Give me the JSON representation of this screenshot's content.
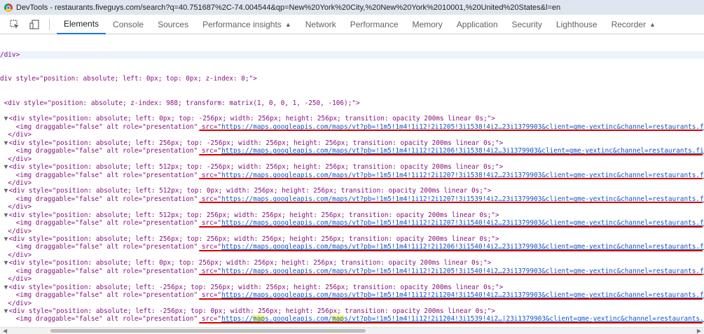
{
  "window": {
    "title": "DevTools - restaurants.fiveguys.com/search?q=40.751687%2C-74.004544&qp=New%20York%20City,%20New%20York%2010001,%20United%20States&l=en"
  },
  "toolbar": {
    "inspect_icon": "element-picker-icon",
    "device_icon": "device-toolbar-icon",
    "tabs": [
      {
        "label": "Elements",
        "active": true
      },
      {
        "label": "Console"
      },
      {
        "label": "Sources"
      },
      {
        "label": "Performance insights",
        "flask": true
      },
      {
        "label": "Network"
      },
      {
        "label": "Performance"
      },
      {
        "label": "Memory"
      },
      {
        "label": "Application"
      },
      {
        "label": "Security"
      },
      {
        "label": "Lighthouse"
      },
      {
        "label": "Recorder",
        "flask": true
      }
    ]
  },
  "code": {
    "line0": "/div>",
    "line1": "div style=\"position: absolute; left: 0px; top: 0px; z-index: 0;\">",
    "line2": "<div style=\"position: absolute; z-index: 988; transform: matrix(1, 0, 0, 1, -250, -106);\">",
    "close_div": "</div>",
    "img_prefix": "<img draggable=\"false\" alt role=\"presentation\" src=\"",
    "blocks": [
      {
        "div": "<div style=\"position: absolute; left: 0px; top: -256px; width: 256px; height: 256px; transition: opacity 200ms linear 0s;\">",
        "url": "https://maps.googleapis.com/maps/vt?pb=!1m5!1m4!1i12!2i1205!3i1538!4i2…23i1379903&client=gme-yextinc&channel=restaurants.five"
      },
      {
        "div": "<div style=\"position: absolute; left: 256px; top: -256px; width: 256px; height: 256px; transition: opacity 200ms linear 0s;\">",
        "url": "https://maps.googleapis.com/maps/vt?pb=!1m5!1m4!1i12!2i1206!3i1538!4i2…3i1379903&client=gme-yextinc&channel=restaurants.fiveg"
      },
      {
        "div": "<div style=\"position: absolute; left: 512px; top: -256px; width: 256px; height: 256px; transition: opacity 200ms linear 0s;\">",
        "url": "https://maps.googleapis.com/maps/vt?pb=!1m5!1m4!1i12!2i1207!3i1538!4i2…23i1379903&client=gme-yextinc&channel=restaurants.five"
      },
      {
        "div": "<div style=\"position: absolute; left: 512px; top: 0px; width: 256px; height: 256px; transition: opacity 200ms linear 0s;\">",
        "url": "https://maps.googleapis.com/maps/vt?pb=!1m5!1m4!1i12!2i1207!3i1539!4i2…23i1379903&client=gme-yextinc&channel=restaurants.five"
      },
      {
        "div": "<div style=\"position: absolute; left: 512px; top: 256px; width: 256px; height: 256px; transition: opacity 200ms linear 0s;\">",
        "url": "https://maps.googleapis.com/maps/vt?pb=!1m5!1m4!1i12!2i1207!3i1540!4i2…23i1379903&client=gme-yextinc&channel=restaurants.five"
      },
      {
        "div": "<div style=\"position: absolute; left: 256px; top: 256px; width: 256px; height: 256px; transition: opacity 200ms linear 0s;\">",
        "url": "https://maps.googleapis.com/maps/vt?pb=!1m5!1m4!1i12!2i1206!3i1540!4i2…23i1379903&client=gme-yextinc&channel=restaurants.five"
      },
      {
        "div": "<div style=\"position: absolute; left: 0px; top: 256px; width: 256px; height: 256px; transition: opacity 200ms linear 0s;\">",
        "url": "https://maps.googleapis.com/maps/vt?pb=!1m5!1m4!1i12!2i1205!3i1540!4i2…23i1379903&client=gme-yextinc&channel=restaurants.five"
      },
      {
        "div": "<div style=\"position: absolute; left: -256px; top: 256px; width: 256px; height: 256px; transition: opacity 200ms linear 0s;\">",
        "url": "https://maps.googleapis.com/maps/vt?pb=!1m5!1m4!1i12!2i1204!3i1540!4i2…23i1379903&client=gme-yextinc&channel=restaurants.five"
      },
      {
        "div": "<div style=\"position: absolute; left: -256px; top: 0px; width: 256px; height: 256px; transition: opacity 200ms linear 0s;\">",
        "url": "https://maps.googleapis.com/maps/vt?pb=!1m5!1m4!1i12!2i1204!3i1539!4i2…|23i1379903&client=gme-yextinc&channel=restaurants.fiv"
      }
    ]
  },
  "colors": {
    "annotation_underline": "#d80000",
    "search_highlight": "#ffff66",
    "tag": "#881280",
    "attr": "#994500",
    "url": "#1155cc"
  }
}
